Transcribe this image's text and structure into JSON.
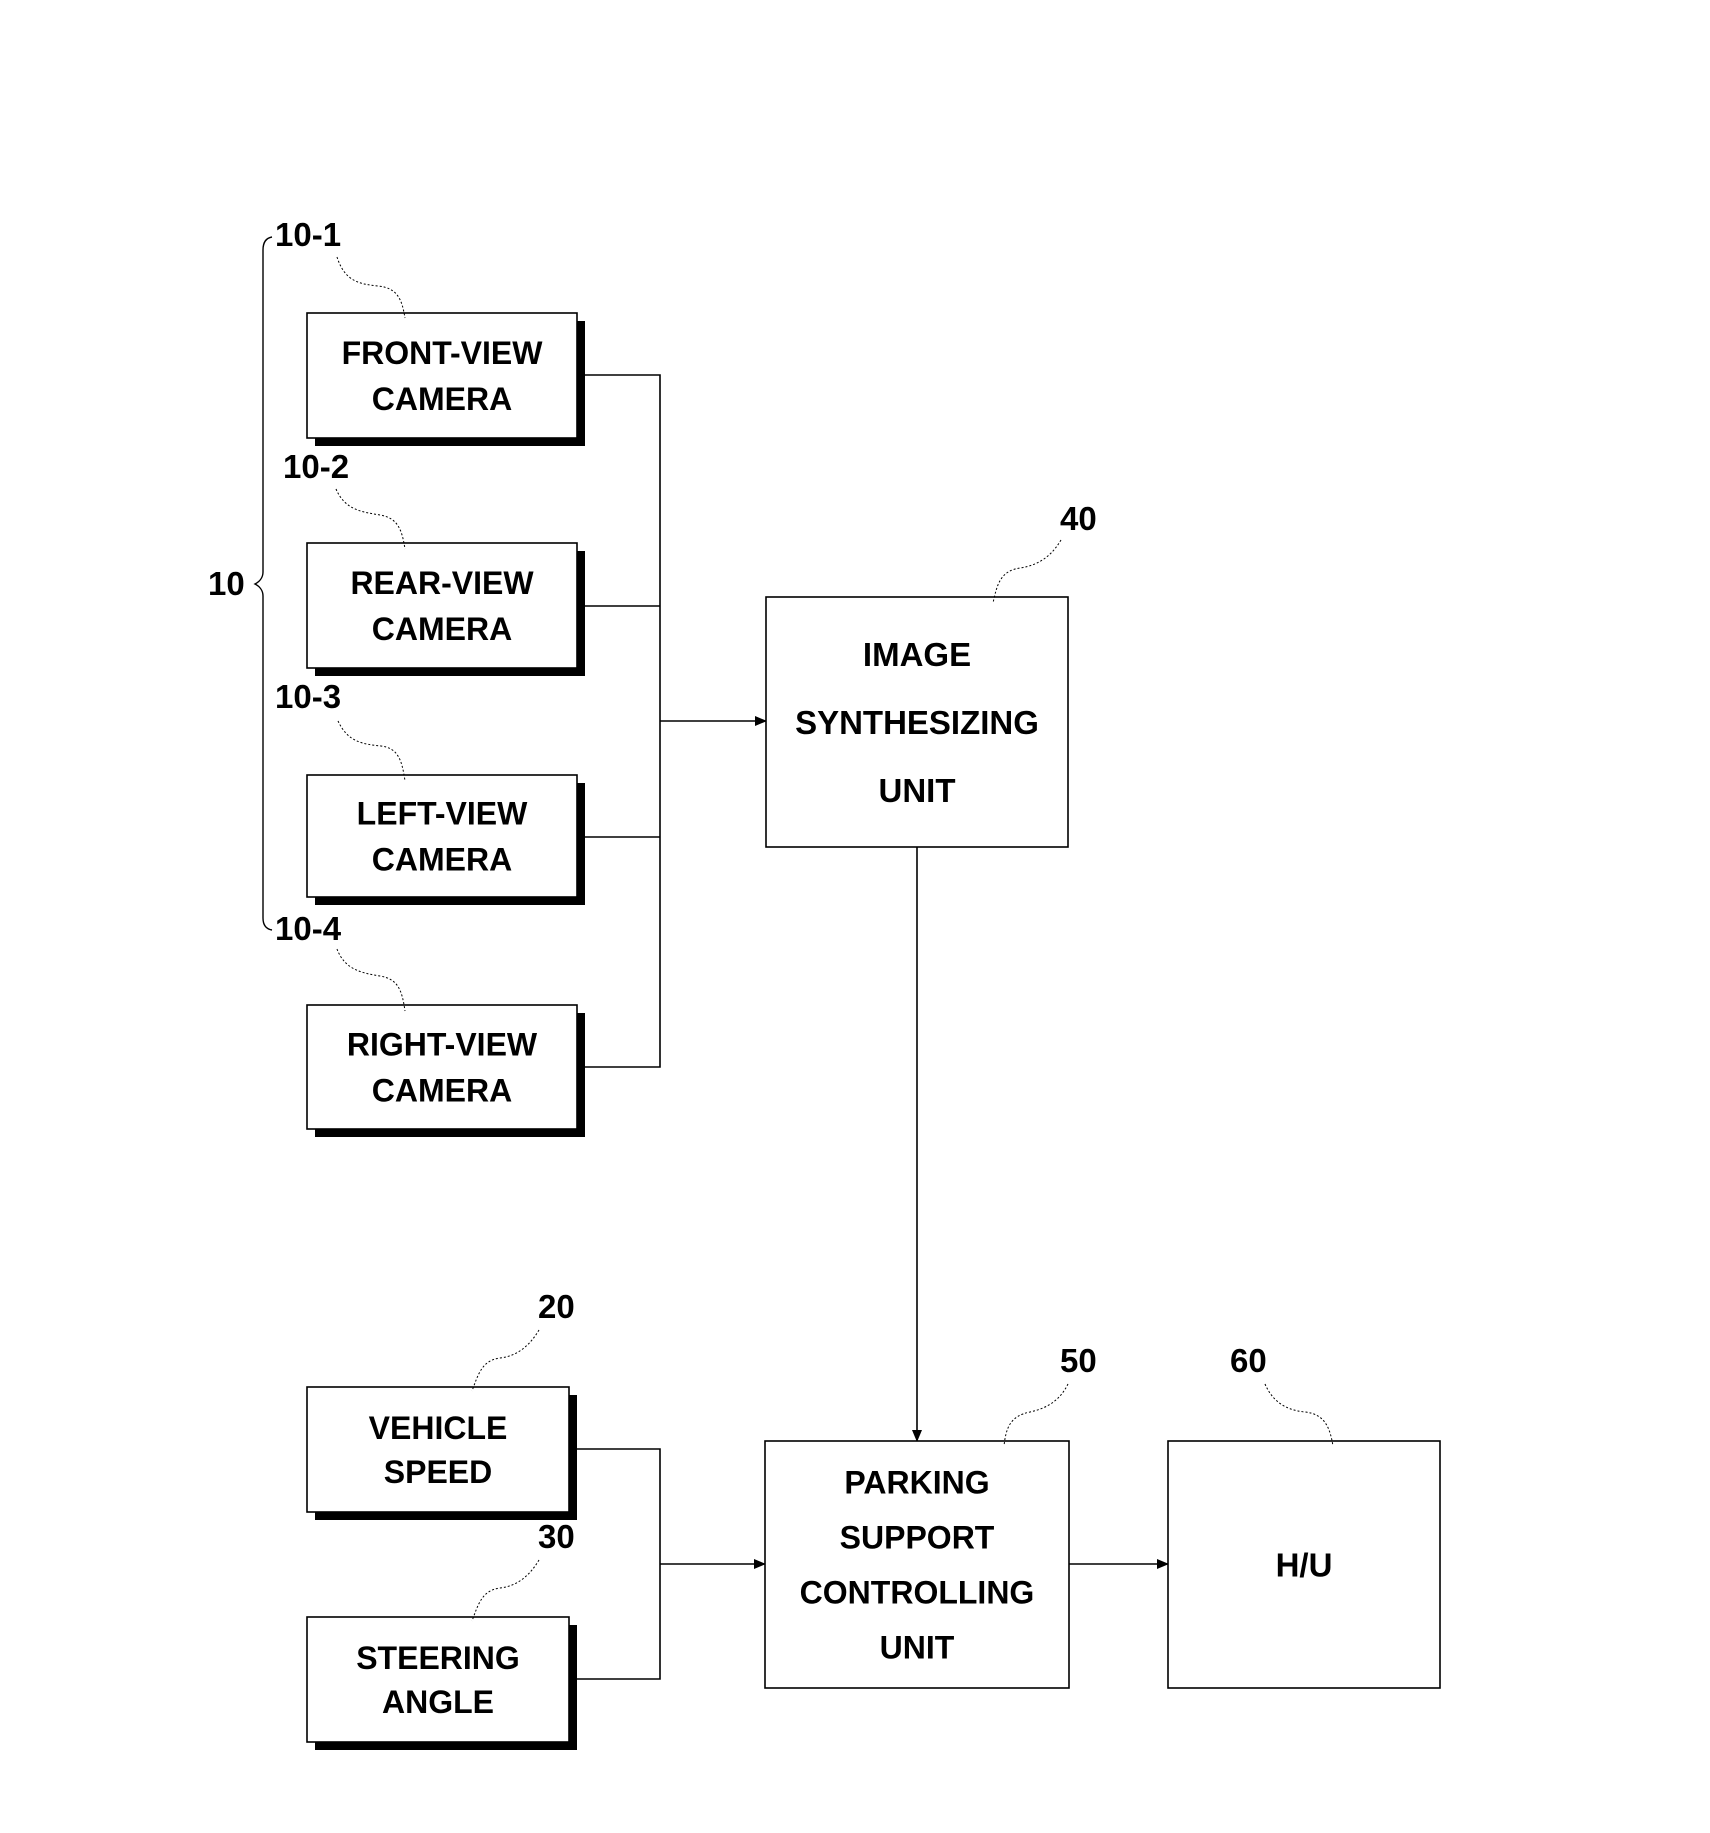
{
  "diagram": {
    "type": "block-diagram",
    "group": {
      "ref": "10",
      "members": [
        "10-1",
        "10-2",
        "10-3",
        "10-4"
      ]
    },
    "blocks": [
      {
        "id": "front",
        "ref": "10-1",
        "lines": [
          "FRONT-VIEW",
          "CAMERA"
        ]
      },
      {
        "id": "rear",
        "ref": "10-2",
        "lines": [
          "REAR-VIEW",
          "CAMERA"
        ]
      },
      {
        "id": "left",
        "ref": "10-3",
        "lines": [
          "LEFT-VIEW",
          "CAMERA"
        ]
      },
      {
        "id": "right",
        "ref": "10-4",
        "lines": [
          "RIGHT-VIEW",
          "CAMERA"
        ]
      },
      {
        "id": "image",
        "ref": "40",
        "lines": [
          "IMAGE",
          "SYNTHESIZING",
          "UNIT"
        ]
      },
      {
        "id": "speed",
        "ref": "20",
        "lines": [
          "VEHICLE",
          "SPEED"
        ]
      },
      {
        "id": "steer",
        "ref": "30",
        "lines": [
          "STEERING",
          "ANGLE"
        ]
      },
      {
        "id": "park",
        "ref": "50",
        "lines": [
          "PARKING",
          "SUPPORT",
          "CONTROLLING",
          "UNIT"
        ]
      },
      {
        "id": "hu",
        "ref": "60",
        "lines": [
          "H/U"
        ]
      }
    ],
    "connections": [
      {
        "from": [
          "front",
          "rear",
          "left",
          "right"
        ],
        "to": "image"
      },
      {
        "from": [
          "image"
        ],
        "to": "park"
      },
      {
        "from": [
          "speed",
          "steer"
        ],
        "to": "park"
      },
      {
        "from": [
          "park"
        ],
        "to": "hu"
      }
    ]
  }
}
